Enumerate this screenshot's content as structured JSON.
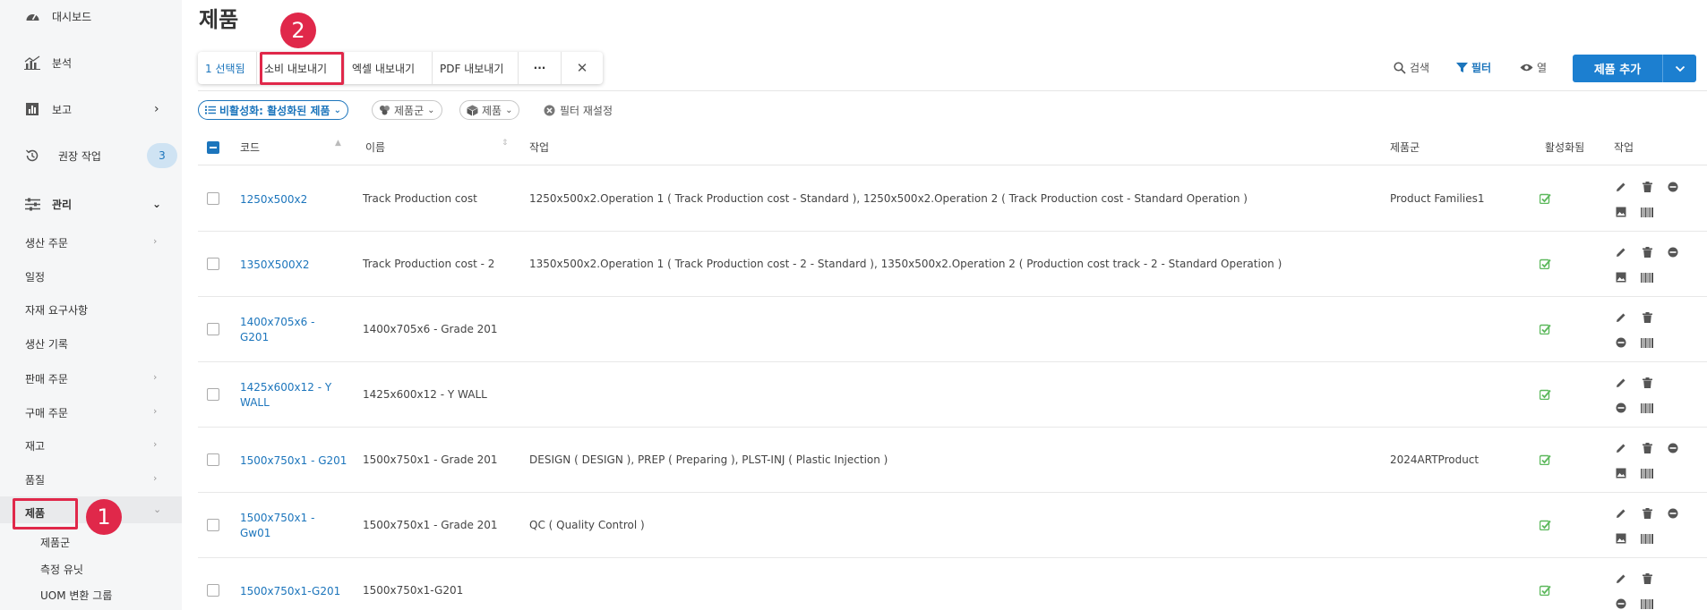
{
  "sidebar": {
    "items": [
      {
        "label": "대시보드",
        "icon": "gauge-icon"
      },
      {
        "label": "분석",
        "icon": "analytics-icon"
      },
      {
        "label": "보고",
        "icon": "report-icon"
      },
      {
        "label": "권장 작업",
        "icon": "history-icon",
        "badge": "3"
      },
      {
        "label": "관리",
        "icon": "sliders-icon"
      }
    ],
    "sub_items": [
      "생산 주문",
      "일정",
      "자재 요구사항",
      "생산 기록",
      "판매 주문",
      "구매 주문",
      "재고",
      "품질",
      "제품"
    ],
    "product_sub_items": [
      "제품군",
      "측정 유닛",
      "UOM 변환 그룹"
    ]
  },
  "page": {
    "title": "제품"
  },
  "toolbar": {
    "selected": "1 선택됨",
    "consume_export": "소비 내보내기",
    "excel_export": "엑셀 내보내기",
    "pdf_export": "PDF 내보내기",
    "more": "···",
    "close": "✕"
  },
  "header_actions": {
    "search": "검색",
    "filter": "필터",
    "columns": "열",
    "add": "제품 추가"
  },
  "filters": {
    "inactive": "비활성화: 활성화된 제품",
    "family": "제품군",
    "product": "제품",
    "reset": "필터 재설정"
  },
  "table": {
    "headers": {
      "code": "코드",
      "name": "이름",
      "operations": "작업",
      "family": "제품군",
      "active": "활성화됨",
      "actions": "작업"
    },
    "rows": [
      {
        "code": [
          "1250x500x2"
        ],
        "name": "Track Production cost",
        "operations": "1250x500x2.Operation 1 ( Track Production cost - Standard ), 1250x500x2.Operation 2 ( Track Production cost - Standard Operation )",
        "family": "Product Families1"
      },
      {
        "code": [
          "1350X500X2"
        ],
        "name": "Track Production cost - 2",
        "operations": "1350x500x2.Operation 1 ( Track Production cost - 2 - Standard ), 1350x500x2.Operation 2 ( Production cost track - 2 - Standard Operation )",
        "family": ""
      },
      {
        "code": [
          "1400x705x6 -",
          "G201"
        ],
        "name": "1400x705x6 - Grade 201",
        "operations": "",
        "family": ""
      },
      {
        "code": [
          "1425x600x12 - Y",
          "WALL"
        ],
        "name": "1425x600x12 - Y WALL",
        "operations": "",
        "family": ""
      },
      {
        "code": [
          "1500x750x1 - G201"
        ],
        "name": "1500x750x1 - Grade 201",
        "operations": "DESIGN ( DESIGN ), PREP ( Preparing ), PLST-INJ ( Plastic Injection )",
        "family": "2024ARTProduct"
      },
      {
        "code": [
          "1500x750x1 -",
          "Gw01"
        ],
        "name": "1500x750x1 - Grade 201",
        "operations": "QC ( Quality Control )",
        "family": ""
      },
      {
        "code": [
          "1500x750x1-G201"
        ],
        "name": "1500x750x1-G201",
        "operations": "",
        "family": ""
      }
    ]
  },
  "annotations": {
    "step1": "1",
    "step2": "2"
  },
  "colors": {
    "accent": "#1c75bc",
    "highlight": "#e0284a",
    "check": "#5cb85c"
  }
}
